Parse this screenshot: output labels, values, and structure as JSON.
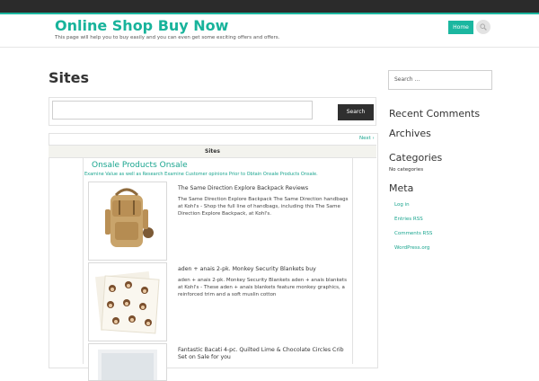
{
  "header": {
    "site_title": "Online Shop Buy Now",
    "site_description": "This page will help you to buy easily and you can even get some exciting offers and offers.",
    "nav": {
      "home_label": "Home"
    },
    "search_icon": "search-icon",
    "accent_color": "#1bb7a0"
  },
  "main": {
    "page_title": "Sites",
    "search": {
      "value": "",
      "button_label": "Search"
    },
    "pagination": {
      "next_label": "Next ›"
    },
    "table": {
      "header_label": "Sites",
      "section_title": "Onsale Products Onsale",
      "section_subtitle": "Examine Value as well as Research Examine Customer opinions Prior to Obtain Onsale Products Onsale.",
      "products": [
        {
          "title": "The Same Direction Explore Backpack Reviews",
          "description": "The Same Direction Explore Backpack The Same Direction handbags at Kohl's - Shop the full line of handbags, including this The Same Direction Explore Backpack, at Kohl's."
        },
        {
          "title": "aden + anais 2-pk. Monkey Security Blankets buy",
          "description": "aden + anais 2-pk. Monkey Security Blankets aden + anais blankets at Kohl's - These aden + anais blankets feature monkey graphics, a reinforced trim and a soft muslin cotton"
        },
        {
          "title": "Fantastic Bacati 4-pc. Quilted Lime & Chocolate Circles Crib Set on Sale for you",
          "description": ""
        }
      ]
    }
  },
  "sidebar": {
    "search_placeholder": "Search ...",
    "recent_comments_title": "Recent Comments",
    "archives_title": "Archives",
    "categories_title": "Categories",
    "categories_empty": "No categories",
    "meta_title": "Meta",
    "meta_links": [
      "Log in",
      "Entries RSS",
      "Comments RSS",
      "WordPress.org"
    ]
  }
}
